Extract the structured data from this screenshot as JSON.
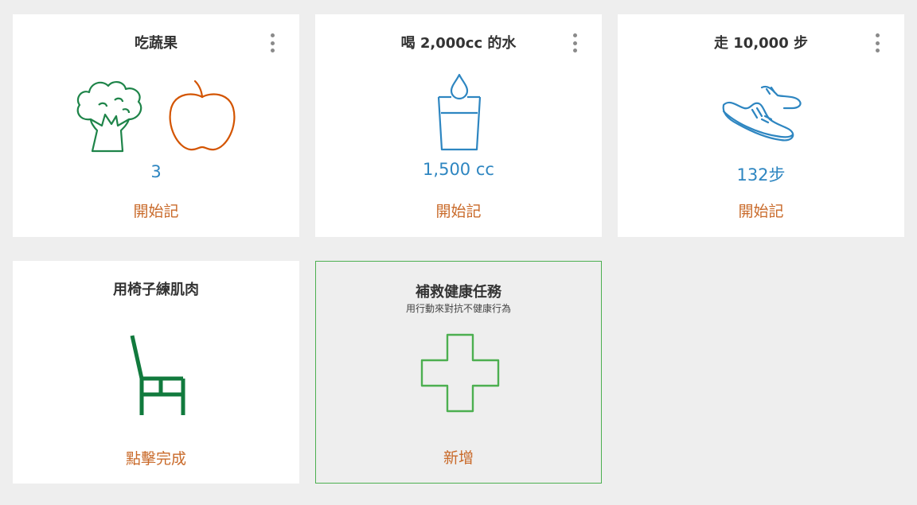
{
  "cards": [
    {
      "title": "吃蔬果",
      "value": "3",
      "action": "開始記",
      "icon": "broccoli-apple-icon"
    },
    {
      "title": "喝 2,000cc 的水",
      "value": "1,500 cc",
      "action": "開始記",
      "icon": "water-glass-icon"
    },
    {
      "title": "走 10,000 步",
      "value": "132步",
      "action": "開始記",
      "icon": "sneaker-icon"
    },
    {
      "title": "用椅子練肌肉",
      "action": "點擊完成",
      "icon": "chair-icon"
    },
    {
      "title": "補救健康任務",
      "subtitle": "用行動來對抗不健康行為",
      "action": "新增",
      "icon": "plus-cross-icon"
    }
  ],
  "colors": {
    "value_blue": "#2e86c1",
    "action_orange": "#c96a2a",
    "broccoli_green": "#1e8449",
    "apple_orange": "#d35400",
    "chair_green": "#117a3d",
    "add_border_green": "#4caf50"
  }
}
